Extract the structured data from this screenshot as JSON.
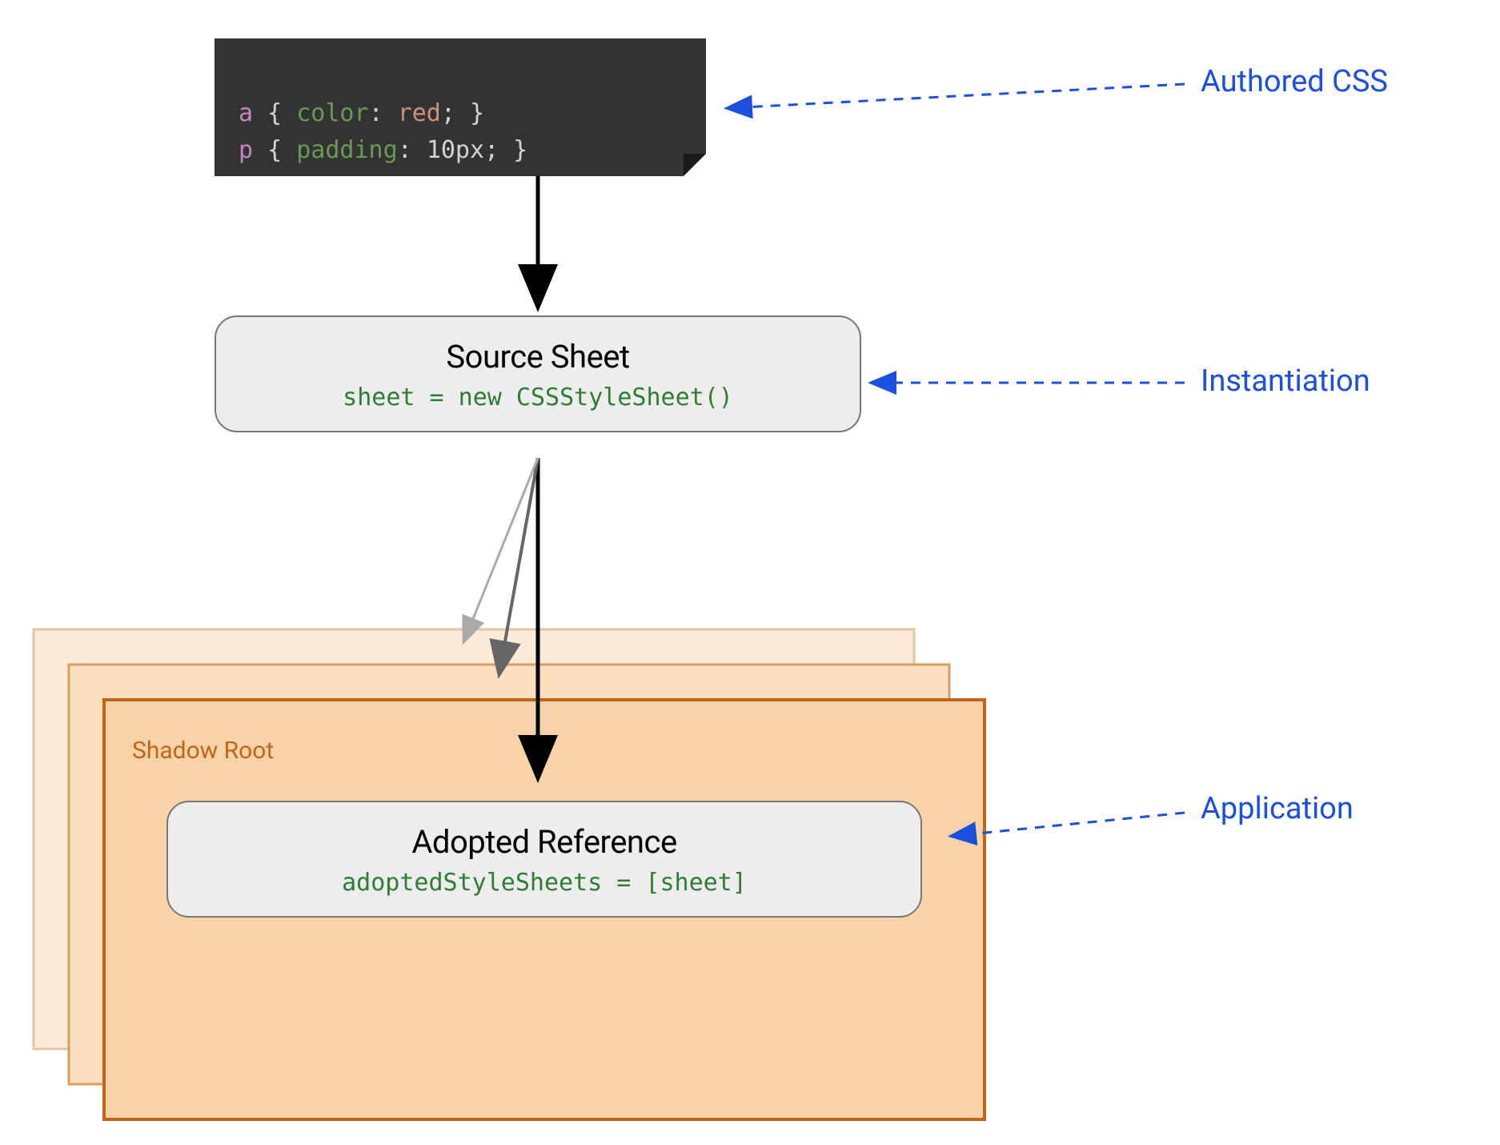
{
  "code": {
    "line1_selector": "a",
    "line1_prop": "color",
    "line1_value": "red",
    "line2_selector": "p",
    "line2_prop": "padding",
    "line2_value": "10px"
  },
  "source_box": {
    "title": "Source Sheet",
    "code": "sheet = new CSSStyleSheet()"
  },
  "shadow_root": {
    "label": "Shadow Root"
  },
  "adopted_box": {
    "title": "Adopted Reference",
    "code": "adoptedStyleSheets = [sheet]"
  },
  "annotations": {
    "authored": "Authored CSS",
    "instantiation": "Instantiation",
    "application": "Application"
  },
  "colors": {
    "blue": "#1a4fe0",
    "orange_border": "#c2641a",
    "orange_fill1": "#fcebd8",
    "orange_fill2": "#fbdfbf",
    "orange_fill3": "#f9d3a8",
    "gray_box": "#ededed",
    "gray_border": "#777777",
    "code_bg": "#333333",
    "code_green": "#2e7d32"
  }
}
